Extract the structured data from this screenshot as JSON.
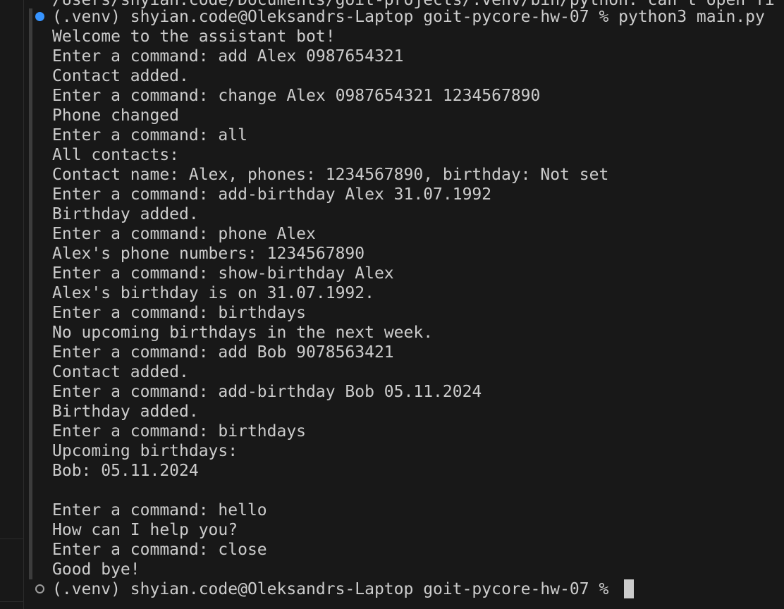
{
  "terminal": {
    "clipped_top": "/Users/shyian.code/Documents/goit-projects/.venv/bin/python: can't open fi",
    "prompt_line": "(.venv) shyian.code@Oleksandrs-Laptop goit-pycore-hw-07 % python3 main.py",
    "output": [
      "Welcome to the assistant bot!",
      "Enter a command: add Alex 0987654321",
      "Contact added.",
      "Enter a command: change Alex 0987654321 1234567890",
      "Phone changed",
      "Enter a command: all",
      "All contacts:",
      "Contact name: Alex, phones: 1234567890, birthday: Not set",
      "Enter a command: add-birthday Alex 31.07.1992",
      "Birthday added.",
      "Enter a command: phone Alex",
      "Alex's phone numbers: 1234567890",
      "Enter a command: show-birthday Alex",
      "Alex's birthday is on 31.07.1992.",
      "Enter a command: birthdays",
      "No upcoming birthdays in the next week.",
      "Enter a command: add Bob 9078563421",
      "Contact added.",
      "Enter a command: add-birthday Bob 05.11.2024",
      "Birthday added.",
      "Enter a command: birthdays",
      "Upcoming birthdays:",
      "Bob: 05.11.2024",
      "",
      "Enter a command: hello",
      "How can I help you?",
      "Enter a command: close",
      "Good bye!"
    ],
    "final_prompt": "(.venv) shyian.code@Oleksandrs-Laptop goit-pycore-hw-07 % ",
    "colors": {
      "background": "#181818",
      "foreground": "#cccccc",
      "success_dot": "#3794ff",
      "idle_dot": "#9d9d9d",
      "command_bar": "#3c3c3c"
    }
  }
}
